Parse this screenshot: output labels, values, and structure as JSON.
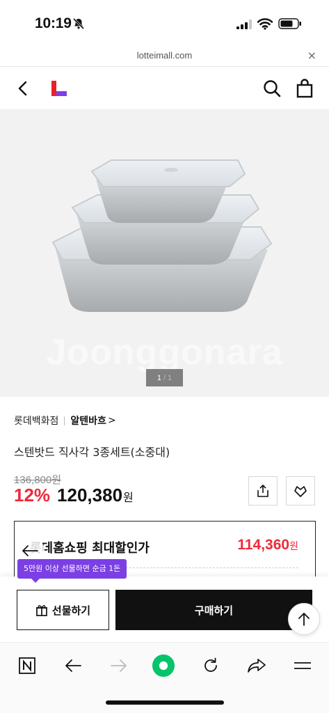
{
  "status_bar": {
    "time": "10:19"
  },
  "browser": {
    "url": "lotteimall.com",
    "close_label": "×"
  },
  "gallery": {
    "watermark": "Joonggonara",
    "page_current": "1",
    "page_separator": "/",
    "page_total": "1"
  },
  "product": {
    "store": "롯데백화점",
    "brand": "알텐바흐",
    "brand_chevron": ">",
    "name": "스텐밧드 직사각 3종세트(소중대)",
    "original_price": "136,800원",
    "discount": "12%",
    "price": "120,380",
    "price_unit": "원"
  },
  "best_price": {
    "label": "롯데홈쇼핑 최대할인가",
    "price": "114,360",
    "unit": "원"
  },
  "purchase": {
    "tooltip": "5만원 이상 선물하면 순금 1돈",
    "gift_label": "선물하기",
    "buy_label": "구매하기"
  },
  "colors": {
    "accent_red": "#ef2a39",
    "tooltip_purple": "#7b3fe4",
    "logo_red": "#e8202b",
    "logo_purple": "#7b3fe4",
    "toolbar_green": "#05c46b"
  }
}
